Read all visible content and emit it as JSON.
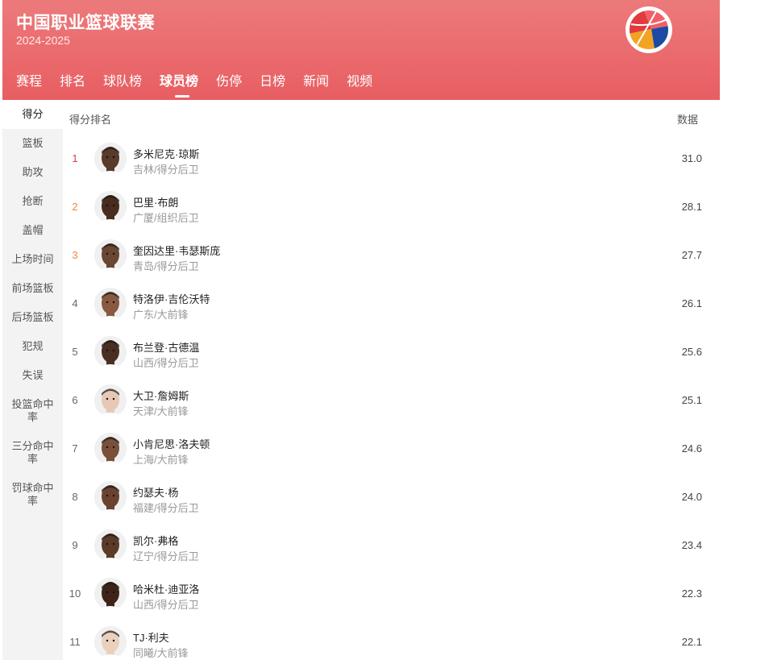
{
  "header": {
    "title": "中国职业篮球联赛",
    "season": "2024-2025",
    "logo_colors": [
      "#e13b3f",
      "#f3a321",
      "#1d4aa2"
    ]
  },
  "nav": {
    "tabs": [
      {
        "label": "赛程"
      },
      {
        "label": "排名"
      },
      {
        "label": "球队榜"
      },
      {
        "label": "球员榜",
        "active": true
      },
      {
        "label": "伤停"
      },
      {
        "label": "日榜"
      },
      {
        "label": "新闻"
      },
      {
        "label": "视频"
      }
    ]
  },
  "sidebar": {
    "items": [
      {
        "label": "得分",
        "active": true
      },
      {
        "label": "篮板"
      },
      {
        "label": "助攻"
      },
      {
        "label": "抢断"
      },
      {
        "label": "盖帽"
      },
      {
        "label": "上场时间"
      },
      {
        "label": "前场篮板"
      },
      {
        "label": "后场篮板"
      },
      {
        "label": "犯规"
      },
      {
        "label": "失误"
      },
      {
        "label": "投篮命中率"
      },
      {
        "label": "三分命中率"
      },
      {
        "label": "罚球命中率"
      }
    ]
  },
  "table": {
    "rank_header": "得分排名",
    "data_header": "数据",
    "rows": [
      {
        "rank": "1",
        "name": "多米尼克·琼斯",
        "team": "吉林/得分后卫",
        "value": "31.0",
        "skin": "#5a3a2a"
      },
      {
        "rank": "2",
        "name": "巴里·布朗",
        "team": "广厦/组织后卫",
        "value": "28.1",
        "skin": "#4a2c1e"
      },
      {
        "rank": "3",
        "name": "奎因达里·韦瑟斯庞",
        "team": "青岛/得分后卫",
        "value": "27.7",
        "skin": "#6b4632"
      },
      {
        "rank": "4",
        "name": "特洛伊·吉伦沃特",
        "team": "广东/大前锋",
        "value": "26.1",
        "skin": "#8a5a40"
      },
      {
        "rank": "5",
        "name": "布兰登·古德温",
        "team": "山西/得分后卫",
        "value": "25.6",
        "skin": "#4b2e22"
      },
      {
        "rank": "6",
        "name": "大卫·詹姆斯",
        "team": "天津/大前锋",
        "value": "25.1",
        "skin": "#e8c8b4"
      },
      {
        "rank": "7",
        "name": "小肯尼思·洛夫顿",
        "team": "上海/大前锋",
        "value": "24.6",
        "skin": "#7a5038"
      },
      {
        "rank": "8",
        "name": "约瑟夫·杨",
        "team": "福建/得分后卫",
        "value": "24.0",
        "skin": "#6a4330"
      },
      {
        "rank": "9",
        "name": "凯尔·弗格",
        "team": "辽宁/得分后卫",
        "value": "23.4",
        "skin": "#5c3a28"
      },
      {
        "rank": "10",
        "name": "哈米杜·迪亚洛",
        "team": "山西/得分后卫",
        "value": "22.3",
        "skin": "#3e2418"
      },
      {
        "rank": "11",
        "name": "TJ·利夫",
        "team": "同曦/大前锋",
        "value": "22.1",
        "skin": "#ecd0be"
      }
    ]
  }
}
